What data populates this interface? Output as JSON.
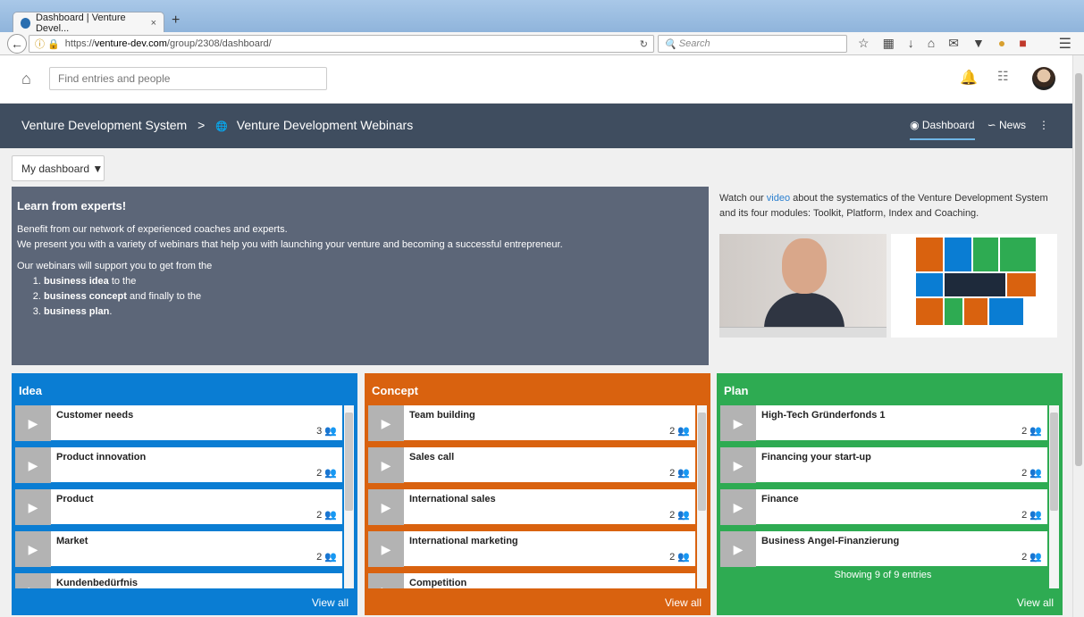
{
  "browser": {
    "tab_title": "Dashboard | Venture Devel...",
    "tab_close": "×",
    "new_tab": "+",
    "url_prefix": "https://",
    "url_host": "venture-dev.com",
    "url_path": "/group/2308/dashboard/",
    "search_placeholder": "Search"
  },
  "topbar": {
    "find_placeholder": "Find entries and people"
  },
  "header": {
    "crumb_root": "Venture Development System",
    "crumb_sep": ">",
    "crumb_current": "Venture Development Webinars",
    "nav_dashboard": "Dashboard",
    "nav_news": "News"
  },
  "my_dashboard": "My dashboard",
  "learn": {
    "title": "Learn from experts!",
    "line1": "Benefit from our network of experienced coaches and experts.",
    "line2": "We present you with a variety of webinars that help you with launching your venture and becoming a successful entrepreneur.",
    "line3": "Our webinars will support you to get from the",
    "steps": [
      {
        "bold": "business idea",
        "rest": " to the"
      },
      {
        "bold": "business concept",
        "rest": " and finally to the"
      },
      {
        "bold": "business plan",
        "rest": "."
      }
    ]
  },
  "video": {
    "desc_a": "Watch our ",
    "desc_link": "video",
    "desc_b": " about the systematics of the Venture Development System and its four modules: Toolkit, Platform, Index and Coaching."
  },
  "columns": [
    {
      "title": "Idea",
      "color": "#0a7dd3",
      "view_all": "View all",
      "items": [
        {
          "name": "Customer needs",
          "count": "3"
        },
        {
          "name": "Product innovation",
          "count": "2"
        },
        {
          "name": "Product",
          "count": "2"
        },
        {
          "name": "Market",
          "count": "2"
        },
        {
          "name": "Kundenbedürfnis",
          "count": ""
        }
      ]
    },
    {
      "title": "Concept",
      "color": "#d9620f",
      "view_all": "View all",
      "items": [
        {
          "name": "Team building",
          "count": "2"
        },
        {
          "name": "Sales call",
          "count": "2"
        },
        {
          "name": "International sales",
          "count": "2"
        },
        {
          "name": "International marketing",
          "count": "2"
        },
        {
          "name": "Competition",
          "count": ""
        }
      ]
    },
    {
      "title": "Plan",
      "color": "#2eab52",
      "view_all": "View all",
      "showing": "Showing 9 of 9 entries",
      "items": [
        {
          "name": "High-Tech Gründerfonds 1",
          "count": "2"
        },
        {
          "name": "Financing your start-up",
          "count": "2"
        },
        {
          "name": "Finance",
          "count": "2"
        },
        {
          "name": "Business Angel-Finanzierung",
          "count": "2"
        }
      ]
    }
  ]
}
